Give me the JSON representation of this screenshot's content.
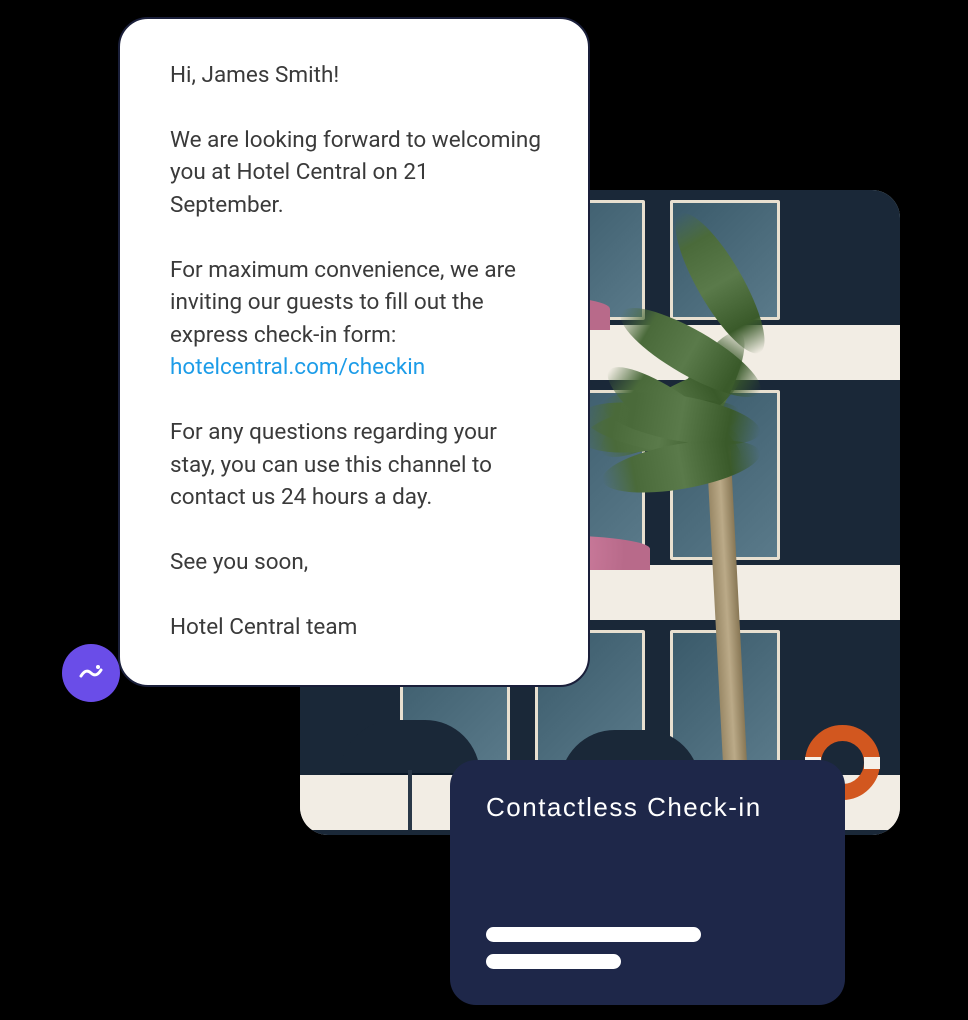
{
  "message": {
    "greeting": "Hi, James Smith!",
    "welcome_text": "We are looking forward to welcoming you at Hotel Central on 21 September.",
    "convenience_text": "For maximum convenience, we are inviting our guests to fill out the express check-in form:",
    "link_text": "hotelcentral.com/checkin",
    "questions_text": "For any questions regarding your stay, you can use this channel to contact us 24 hours a day.",
    "closing": "See you soon,",
    "signature": "Hotel Central team"
  },
  "checkin_card": {
    "title": "Contactless Check-in"
  }
}
